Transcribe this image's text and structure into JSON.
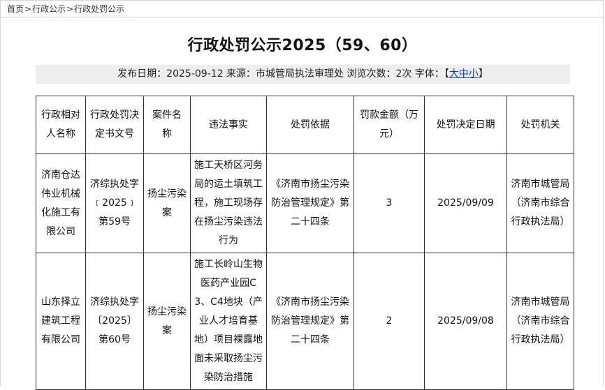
{
  "breadcrumb": {
    "items": [
      "首页",
      "行政公示",
      "行政处罚公示"
    ],
    "separator": ">"
  },
  "article": {
    "title": "行政处罚公示2025（59、60）",
    "meta_prefix": "发布日期：2025-09-12 来源：市城管局执法审理处 浏览次数：2次 字体：",
    "font_bracket_open": "【",
    "font_size_label": "大中小",
    "font_bracket_close": "】"
  },
  "table": {
    "headers": [
      "行政相对人名称",
      "行政处罚决定书文号",
      "案件名称",
      "违法事实",
      "处罚依据",
      "罚款金额（万元）",
      "处罚决定日期",
      "处罚机关"
    ],
    "rows": [
      [
        "济南仓达伟业机械化施工有限公司",
        "济综执处字﹝2025﹞第59号",
        "扬尘污染案",
        "施工天桥区河务局的运土填筑工程，施工现场存在扬尘污染违法行为",
        "《济南市扬尘污染防治管理规定》第二十四条",
        "3",
        "2025/09/09",
        "济南市城管局（济南市综合行政执法局）"
      ],
      [
        "山东择立建筑工程有限公司",
        "济综执处字〔2025〕第60号",
        "扬尘污染案",
        "施工长岭山生物医药产业园C3、C4地块（产业人才培育基地）项目裸露地面未采取扬尘污染防治措施",
        "《济南市扬尘污染防治管理规定》第二十四条",
        "2",
        "2025/09/08",
        "济南市城管局（济南市综合行政执法局）"
      ]
    ]
  }
}
